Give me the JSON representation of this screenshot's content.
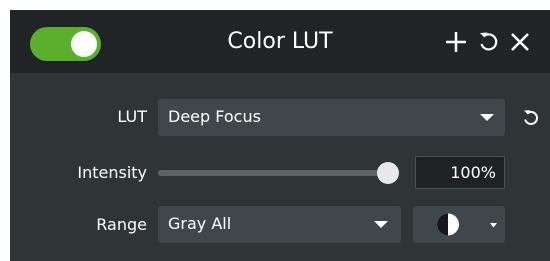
{
  "header": {
    "toggle_state": "on",
    "title": "Color LUT",
    "icons": [
      "plus-icon",
      "reset-icon",
      "close-icon"
    ]
  },
  "lut": {
    "label": "LUT",
    "value": "Deep Focus"
  },
  "intensity": {
    "label": "Intensity",
    "value": "100%",
    "level": 1.0
  },
  "range": {
    "label": "Range",
    "value": "Gray All",
    "mode_icon": "half-circle-icon"
  },
  "colors": {
    "accent": "#5ab02c",
    "panel": "#2f3437",
    "header": "#212426"
  }
}
